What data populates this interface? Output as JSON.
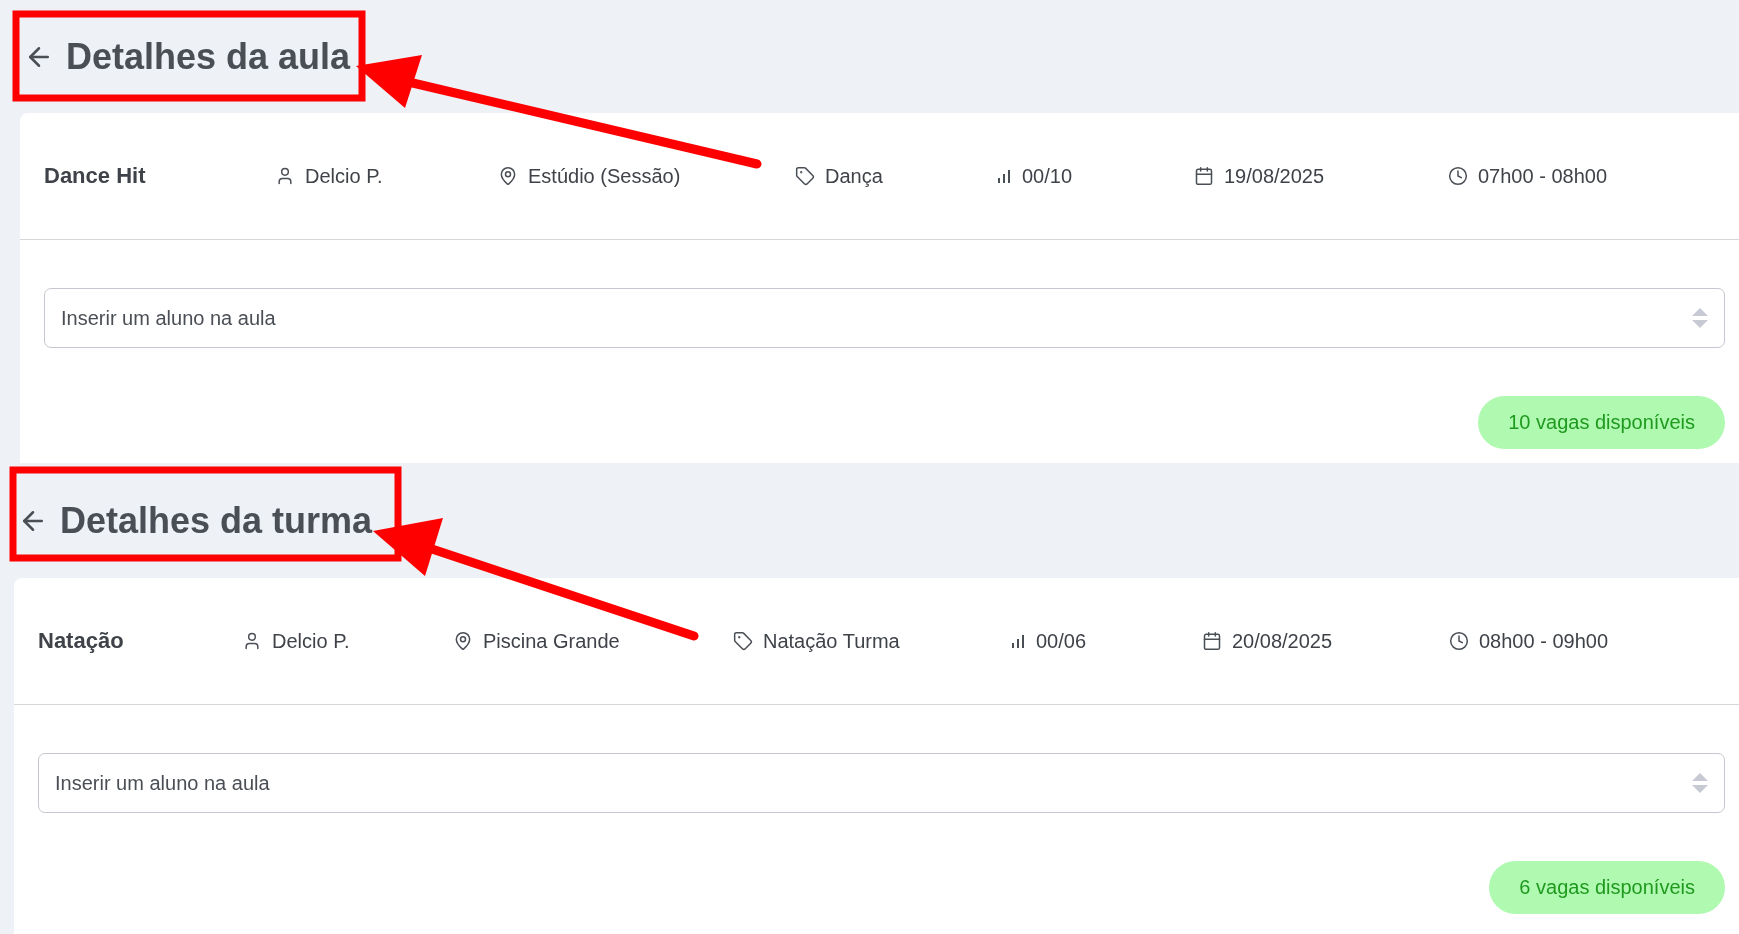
{
  "sections": [
    {
      "title": "Detalhes da aula",
      "class_name": "Dance Hit",
      "details": [
        {
          "kind": "instructor",
          "text": "Delcio P."
        },
        {
          "kind": "location",
          "text": "Estúdio (Sessão)"
        },
        {
          "kind": "category",
          "text": "Dança"
        },
        {
          "kind": "capacity",
          "text": "00/10"
        },
        {
          "kind": "date",
          "text": "19/08/2025"
        },
        {
          "kind": "time",
          "text": "07h00 - 08h00"
        }
      ],
      "student_select": {
        "placeholder": "Inserir um aluno na aula"
      },
      "availability_badge": "10 vagas disponíveis"
    },
    {
      "title": "Detalhes da turma",
      "class_name": "Natação",
      "details": [
        {
          "kind": "instructor",
          "text": "Delcio P."
        },
        {
          "kind": "location",
          "text": "Piscina Grande"
        },
        {
          "kind": "category",
          "text": "Natação Turma"
        },
        {
          "kind": "capacity",
          "text": "00/06"
        },
        {
          "kind": "date",
          "text": "20/08/2025"
        },
        {
          "kind": "time",
          "text": "08h00 - 09h00"
        }
      ],
      "student_select": {
        "placeholder": "Inserir um aluno na aula"
      },
      "availability_badge": "6 vagas disponíveis"
    }
  ]
}
